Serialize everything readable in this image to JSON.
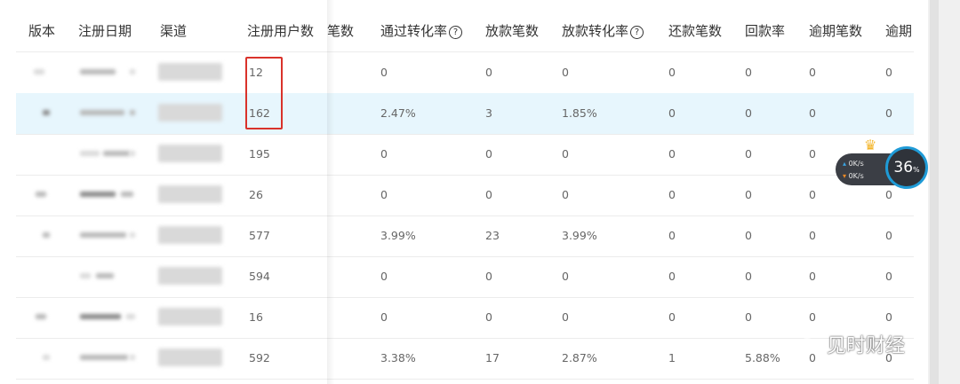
{
  "columns": [
    {
      "key": "version",
      "label": "版本"
    },
    {
      "key": "reg_date",
      "label": "注册日期"
    },
    {
      "key": "channel",
      "label": "渠道"
    },
    {
      "key": "reg_users",
      "label": "注册用户数"
    },
    {
      "key": "apply_count",
      "label": "笔数"
    },
    {
      "key": "pass_rate",
      "label": "通过转化率",
      "help": "?"
    },
    {
      "key": "loan_count",
      "label": "放款笔数"
    },
    {
      "key": "loan_rate",
      "label": "放款转化率",
      "help": "?"
    },
    {
      "key": "repay_count",
      "label": "还款笔数"
    },
    {
      "key": "repay_rate",
      "label": "回款率"
    },
    {
      "key": "overdue_count",
      "label": "逾期笔数"
    },
    {
      "key": "overdue_more",
      "label": "逾期"
    }
  ],
  "rows": [
    {
      "reg_users": "12",
      "pass_rate": "0",
      "loan_count": "0",
      "loan_rate": "0",
      "repay_count": "0",
      "repay_rate": "0",
      "overdue_count": "0",
      "overdue_more": "0"
    },
    {
      "reg_users": "162",
      "pass_rate": "2.47%",
      "loan_count": "3",
      "loan_rate": "1.85%",
      "repay_count": "0",
      "repay_rate": "0",
      "overdue_count": "0",
      "overdue_more": "0",
      "highlight": true
    },
    {
      "reg_users": "195",
      "pass_rate": "0",
      "loan_count": "0",
      "loan_rate": "0",
      "repay_count": "0",
      "repay_rate": "0",
      "overdue_count": "0",
      "overdue_more": ""
    },
    {
      "reg_users": "26",
      "pass_rate": "0",
      "loan_count": "0",
      "loan_rate": "0",
      "repay_count": "0",
      "repay_rate": "0",
      "overdue_count": "0",
      "overdue_more": "0"
    },
    {
      "reg_users": "577",
      "pass_rate": "3.99%",
      "loan_count": "23",
      "loan_rate": "3.99%",
      "repay_count": "0",
      "repay_rate": "0",
      "overdue_count": "0",
      "overdue_more": "0"
    },
    {
      "reg_users": "594",
      "pass_rate": "0",
      "loan_count": "0",
      "loan_rate": "0",
      "repay_count": "0",
      "repay_rate": "0",
      "overdue_count": "0",
      "overdue_more": "0"
    },
    {
      "reg_users": "16",
      "pass_rate": "0",
      "loan_count": "0",
      "loan_rate": "0",
      "repay_count": "0",
      "repay_rate": "0",
      "overdue_count": "0",
      "overdue_more": "0"
    },
    {
      "reg_users": "592",
      "pass_rate": "3.38%",
      "loan_count": "17",
      "loan_rate": "2.87%",
      "repay_count": "1",
      "repay_rate": "5.88%",
      "overdue_count": "0",
      "overdue_more": "0"
    }
  ],
  "net_widget": {
    "up": "0K/s",
    "down": "0K/s",
    "percent": "36",
    "percent_unit": "%"
  },
  "watermark": {
    "text": "见时财经"
  },
  "colors": {
    "highlight_row": "#e7f6fd",
    "annotation_box": "#d9322b",
    "widget_ring": "#1f9bd7"
  }
}
